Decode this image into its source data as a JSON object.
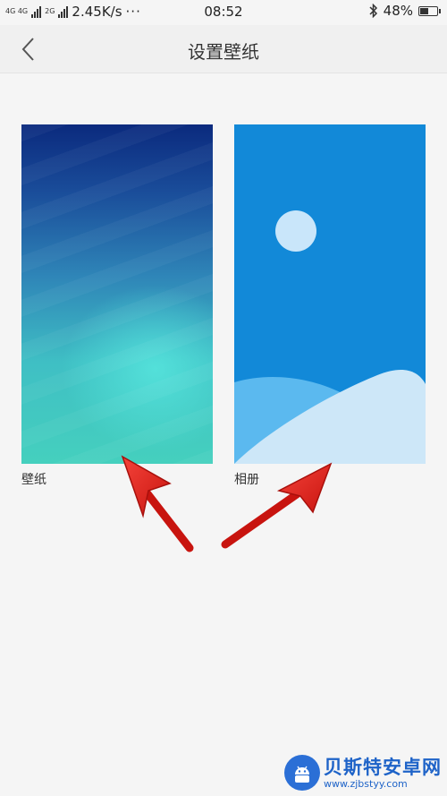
{
  "status_bar": {
    "network_tag_1": "4G 4G",
    "network_tag_2": "2G",
    "speed": "2.45K/s",
    "dots": "···",
    "time": "08:52",
    "battery": "48%",
    "icons": [
      "signal-icon",
      "bluetooth-icon",
      "battery-icon"
    ]
  },
  "header": {
    "title": "设置壁纸",
    "back_icon": "chevron-left-icon"
  },
  "tiles": [
    {
      "label": "壁纸",
      "kind": "wallpaper-preview"
    },
    {
      "label": "相册",
      "kind": "album-icon"
    }
  ],
  "colors": {
    "background": "#f5f5f5",
    "album_blue": "#1289d8",
    "arrow_red": "#e8231d"
  },
  "watermark": {
    "main": "贝斯特安卓网",
    "sub": "www.zjbstyy.com"
  }
}
